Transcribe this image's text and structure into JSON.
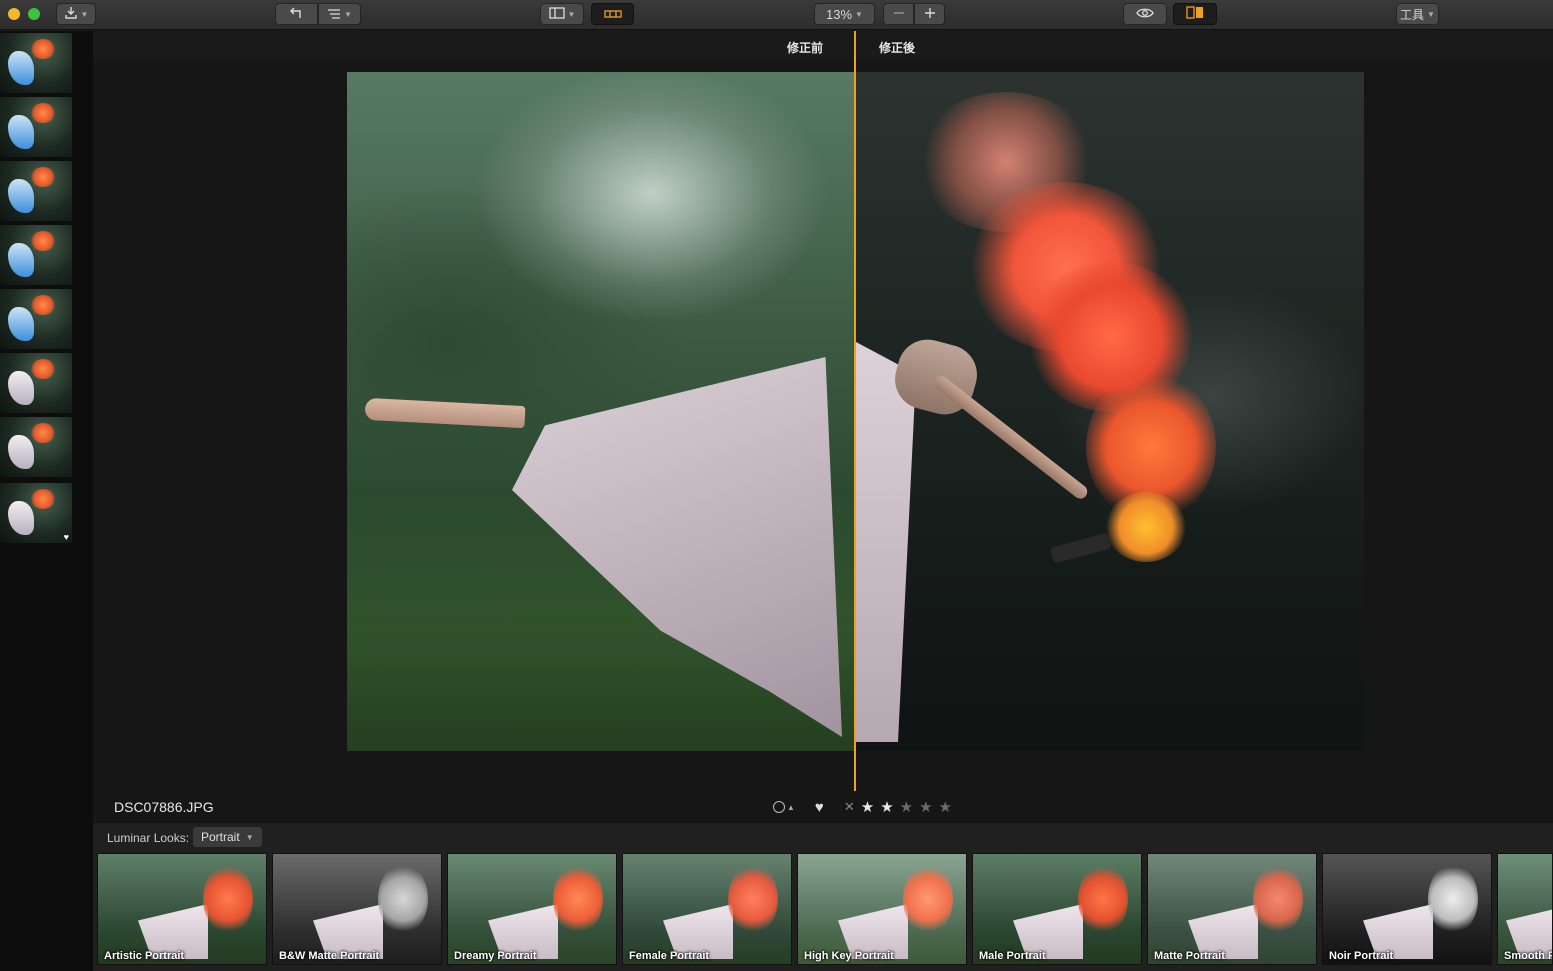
{
  "toolbar": {
    "zoom": "13%",
    "tools_label": "工具",
    "icons": [
      "export-icon",
      "undo-icon",
      "history-icon",
      "layout-icon",
      "filmstrip-icon",
      "zoom-out-icon",
      "zoom-in-icon",
      "preview-eye-icon",
      "compare-icon"
    ]
  },
  "compare": {
    "before_label": "修正前",
    "after_label": "修正後"
  },
  "info": {
    "filename": "DSC07886.JPG",
    "rating": 2,
    "stars": [
      "★",
      "★",
      "★",
      "★",
      "★"
    ],
    "reject_symbol": "✕",
    "favorite_symbol": "♥"
  },
  "looks": {
    "label": "Luminar Looks:",
    "selected": "Portrait",
    "items": [
      {
        "name": "Artistic Portrait"
      },
      {
        "name": "B&W Matte Portrait"
      },
      {
        "name": "Dreamy Portrait"
      },
      {
        "name": "Female Portrait"
      },
      {
        "name": "High Key Portrait"
      },
      {
        "name": "Male Portrait"
      },
      {
        "name": "Matte Portrait"
      },
      {
        "name": "Noir Portrait"
      },
      {
        "name": "Smooth P"
      }
    ]
  },
  "colors": {
    "accent": "#f0a21f",
    "close_light": "#f5b82e",
    "zoom_light": "#3fc23c"
  }
}
